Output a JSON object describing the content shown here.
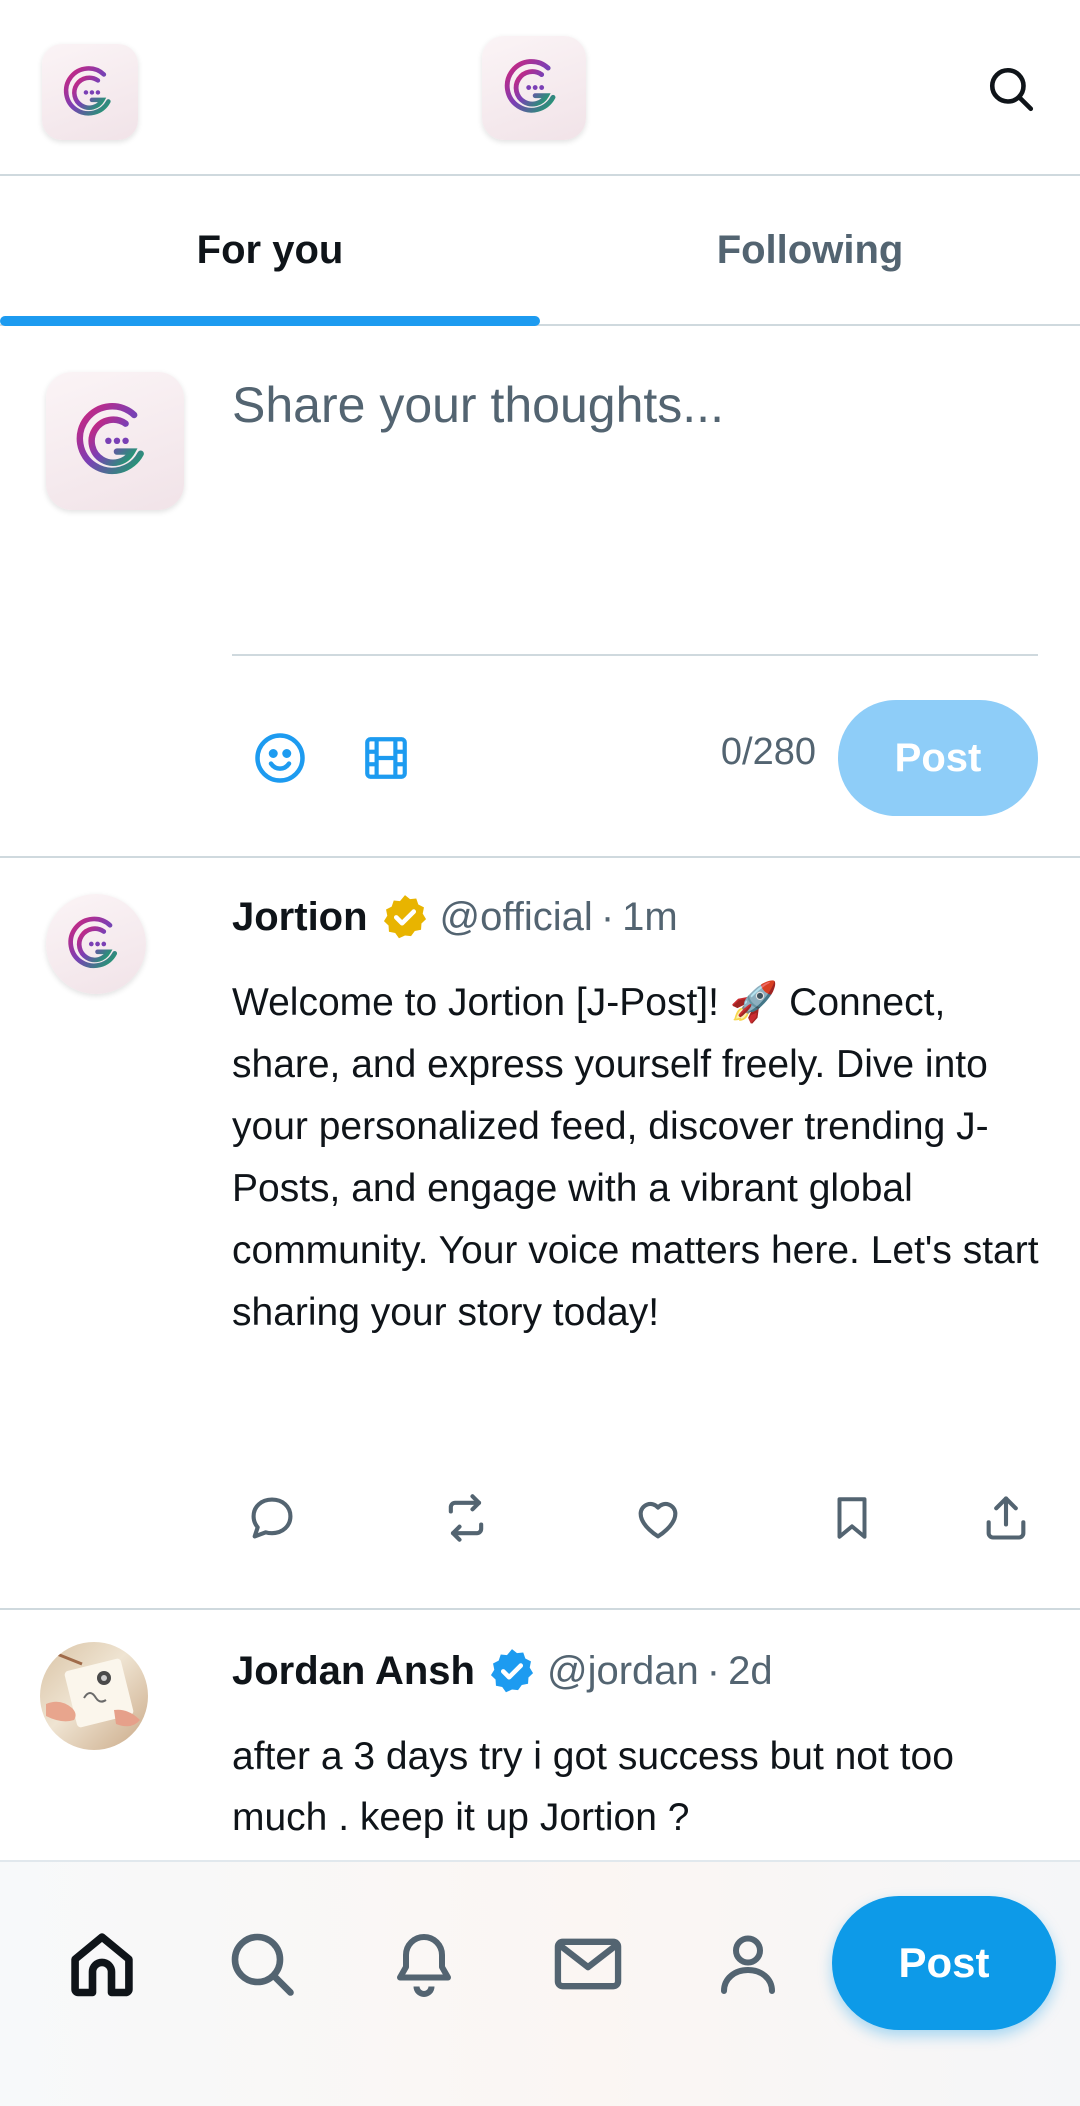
{
  "header": {
    "logo_icon": "jortion-logo-icon",
    "search_icon": "search-icon"
  },
  "tabs": [
    {
      "label": "For you",
      "active": true
    },
    {
      "label": "Following",
      "active": false
    }
  ],
  "composer": {
    "placeholder": "Share your thoughts...",
    "char_count": "0/280",
    "post_label": "Post",
    "tools": [
      "emoji-icon",
      "media-icon"
    ]
  },
  "posts": [
    {
      "name": "Jortion",
      "verified": "gold",
      "handle": "@official",
      "separator": "·",
      "time": "1m",
      "body": "Welcome to Jortion [J-Post]! 🚀 Connect, share, and express yourself freely. Dive into your personalized feed, discover trending J-Posts, and engage with a vibrant global community. Your voice matters here. Let's start sharing your story today!",
      "actions": [
        "reply-icon",
        "repost-icon",
        "like-icon",
        "bookmark-icon",
        "share-icon"
      ]
    },
    {
      "name": "Jordan Ansh",
      "verified": "blue",
      "handle": "@jordan",
      "separator": "·",
      "time": "2d",
      "body": "after a 3 days try i got success but not too much . keep it up Jortion ?"
    }
  ],
  "bottom_nav": {
    "items": [
      "home-icon",
      "search-icon",
      "notifications-icon",
      "messages-icon",
      "profile-icon"
    ],
    "post_label": "Post"
  },
  "colors": {
    "accent": "#1d9bf0",
    "accent_light": "#8ecdf8",
    "gold_badge": "#e8b400",
    "muted": "#536471"
  }
}
